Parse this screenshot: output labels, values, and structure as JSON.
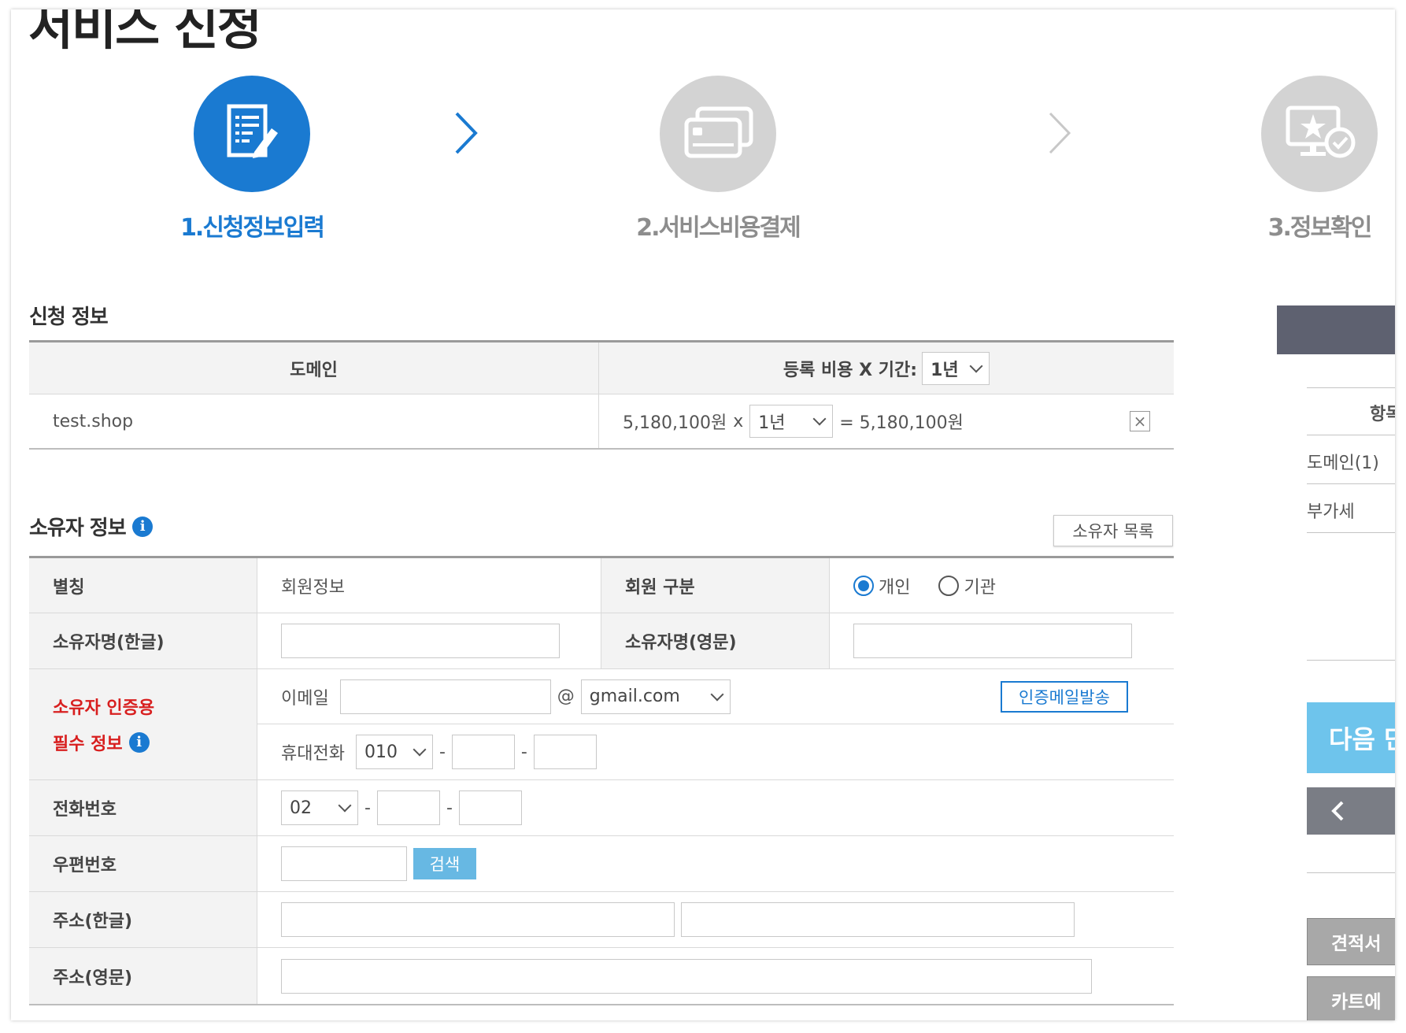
{
  "page": {
    "title": "서비스 신청"
  },
  "steps": [
    {
      "label": "1.신청정보입력",
      "icon": "form-edit-icon"
    },
    {
      "label": "2.서비스비용결제",
      "icon": "credit-card-icon"
    },
    {
      "label": "3.정보확인",
      "icon": "monitor-star-check-icon"
    }
  ],
  "application": {
    "section_title": "신청 정보",
    "header": {
      "domain": "도메인",
      "cost_period": "등록 비용 X 기간:",
      "period_select": "1년"
    },
    "rows": [
      {
        "domain": "test.shop",
        "price": "5,180,100원",
        "multiplier": "x",
        "period": "1년",
        "total": "= 5,180,100원"
      }
    ]
  },
  "owner": {
    "section_title": "소유자 정보",
    "list_button": "소유자 목록",
    "nickname_label": "별칭",
    "nickname_value": "회원정보",
    "member_type_label": "회원 구분",
    "member_type_options": [
      "개인",
      "기관"
    ],
    "member_type_selected": "개인",
    "name_kr_label": "소유자명(한글)",
    "name_en_label": "소유자명(영문)",
    "auth_label_line1": "소유자 인증용",
    "auth_label_line2": "필수 정보",
    "email_label": "이메일",
    "email_at": "@",
    "email_domain": "gmail.com",
    "verify_button": "인증메일발송",
    "mobile_label": "휴대전화",
    "mobile_prefix": "010",
    "dash": "-",
    "phone_label": "전화번호",
    "phone_prefix": "02",
    "zip_label": "우편번호",
    "search_button": "검색",
    "addr_kr_label": "주소(한글)",
    "addr_en_label": "주소(영문)"
  },
  "side_panel": {
    "header": "항목",
    "items": [
      "도메인(1)",
      "부가세"
    ],
    "next_button": "다음 단",
    "back_icon": "chevron-left-icon",
    "quote_button": "견적서",
    "cart_button": "카트에"
  },
  "colors": {
    "accent": "#1a7ad1",
    "required": "#d81f1f",
    "search_button": "#67b8e3",
    "next_button": "#6ec4ec"
  }
}
